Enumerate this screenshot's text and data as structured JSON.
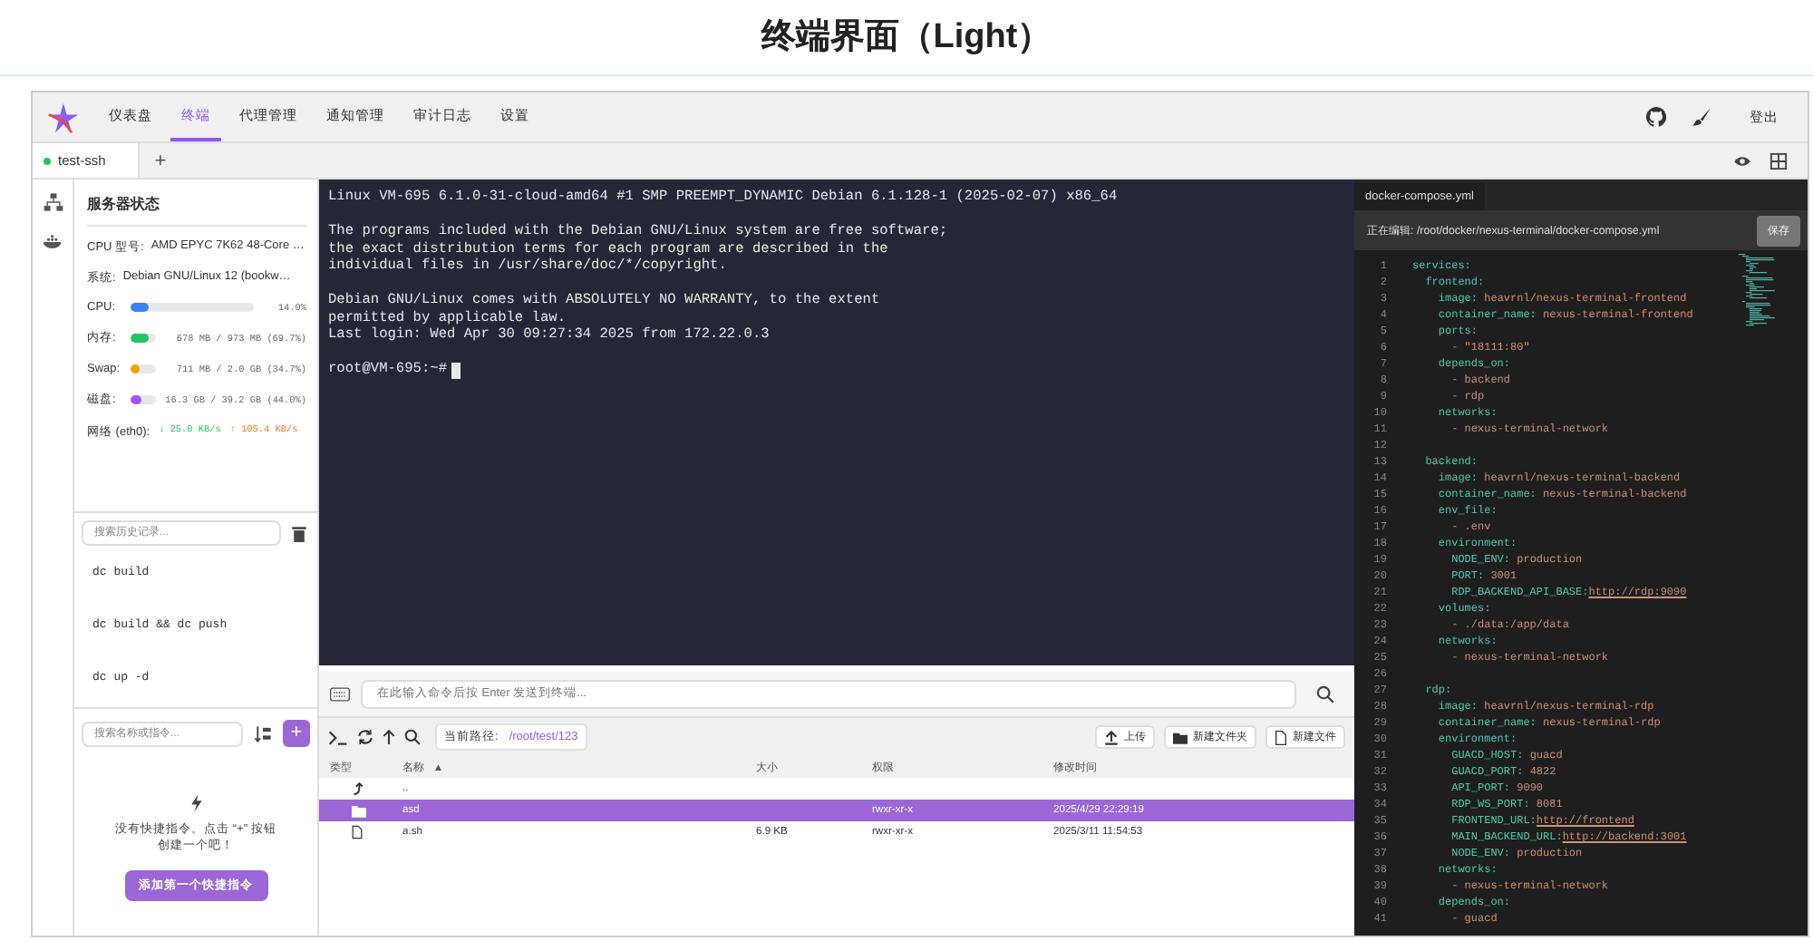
{
  "page_title": "终端界面（Light）",
  "nav": {
    "items": [
      {
        "label": "仪表盘",
        "selected": false
      },
      {
        "label": "终端",
        "selected": true
      },
      {
        "label": "代理管理",
        "selected": false
      },
      {
        "label": "通知管理",
        "selected": false
      },
      {
        "label": "审计日志",
        "selected": false
      },
      {
        "label": "设置",
        "selected": false
      }
    ],
    "logout": "登出"
  },
  "tabs": [
    {
      "label": "test-ssh",
      "selected": true,
      "connected": true
    }
  ],
  "add_tab": "+",
  "status": {
    "title": "服务器状态",
    "cpu_model_label": "CPU 型号:",
    "cpu_model": "AMD EPYC 7K62 48-Core …",
    "os_label": "系统:",
    "os": "Debian GNU/Linux 12 (bookw…",
    "meters": [
      {
        "label": "CPU:",
        "level": 0.14,
        "reading": "14.0%",
        "color": "#3b82f6"
      },
      {
        "label": "内存:",
        "level": 0.697,
        "reading": "678 MB / 973 MB (69.7%)",
        "color": "#22c55e"
      },
      {
        "label": "Swap:",
        "level": 0.347,
        "reading": "711 MB / 2.0 GB (34.7%)",
        "color": "#f59e0b"
      },
      {
        "label": "磁盘:",
        "level": 0.44,
        "reading": "16.3 GB / 39.2 GB (44.0%)",
        "color": "#a855f7"
      }
    ],
    "network": {
      "label": "网络 (eth0):",
      "down": "↓ 25.0 KB/s",
      "up": "↑ 105.4 KB/s"
    }
  },
  "history": {
    "placeholder": "搜索历史记录...",
    "items": [
      "dc build",
      "dc build && dc push",
      "dc up -d"
    ]
  },
  "quick": {
    "placeholder": "搜索名称或指令...",
    "add_symbol": "+",
    "empty_text": "没有快捷指令。点击 “+” 按钮创建一个吧！",
    "add_button": "添加第一个快捷指令"
  },
  "terminal": {
    "blocks": [
      [
        "Linux VM-695 6.1.0-31-cloud-amd64 #1 SMP PREEMPT_DYNAMIC Debian 6.1.128-1 (2025-02-07) x86_64"
      ],
      [
        "The programs included with the Debian GNU/Linux system are free software;",
        "the exact distribution terms for each program are described in the",
        "individual files in /usr/share/doc/*/copyright."
      ],
      [
        "Debian GNU/Linux comes with ABSOLUTELY NO WARRANTY, to the extent",
        "permitted by applicable law.",
        "Last login: Wed Apr 30 09:27:34 2025 from 172.22.0.3"
      ]
    ],
    "prompt": "root@VM-695:~#"
  },
  "command_input": {
    "placeholder": "在此输入命令后按 Enter 发送到终端..."
  },
  "files": {
    "path_label": "当前路径:",
    "path": "/root/test/123",
    "buttons": [
      "上传",
      "新建文件夹",
      "新建文件"
    ],
    "columns": [
      "类型",
      "名称",
      "大小",
      "权限",
      "修改时间"
    ],
    "sort_mark": "▲",
    "rows": [
      {
        "kind": "up",
        "name": "..",
        "selected": false
      },
      {
        "kind": "folder",
        "name": "asd",
        "perms": "rwxr-xr-x",
        "modified": "2025/4/29 22:29:19",
        "selected": true
      },
      {
        "kind": "file",
        "name": "a.sh",
        "size": "6.9 KB",
        "perms": "rwxr-xr-x",
        "modified": "2025/3/11 11:54:53",
        "selected": false
      }
    ]
  },
  "editor": {
    "tab": "docker-compose.yml",
    "editing_label": "正在编辑:",
    "path": "/root/docker/nexus-terminal/docker-compose.yml",
    "save": "保存",
    "lines": [
      {
        "n": "1",
        "k": "services:"
      },
      {
        "n": "2",
        "k": "  frontend:"
      },
      {
        "n": "3",
        "k": "    image:",
        "v": " heavrnl/nexus-terminal-frontend"
      },
      {
        "n": "4",
        "k": "    container_name:",
        "v": " nexus-terminal-frontend"
      },
      {
        "n": "5",
        "k": "    ports:"
      },
      {
        "n": "6",
        "v": "      - \"18111:80\""
      },
      {
        "n": "7",
        "k": "    depends_on:"
      },
      {
        "n": "8",
        "v": "      - backend"
      },
      {
        "n": "9",
        "v": "      - rdp"
      },
      {
        "n": "10",
        "k": "    networks:"
      },
      {
        "n": "11",
        "v": "      - nexus-terminal-network"
      },
      {
        "n": "12"
      },
      {
        "n": "13",
        "k": "  backend:"
      },
      {
        "n": "14",
        "k": "    image:",
        "v": " heavrnl/nexus-terminal-backend"
      },
      {
        "n": "15",
        "k": "    container_name:",
        "v": " nexus-terminal-backend"
      },
      {
        "n": "16",
        "k": "    env_file:"
      },
      {
        "n": "17",
        "v": "      - .env"
      },
      {
        "n": "18",
        "k": "    environment:"
      },
      {
        "n": "19",
        "k": "      NODE_ENV:",
        "v": " production"
      },
      {
        "n": "20",
        "k": "      PORT:",
        "v": " 3001"
      },
      {
        "n": "21",
        "k": "      RDP_BACKEND_API_BASE:",
        "v": "http://rdp:9090",
        "link": true
      },
      {
        "n": "22",
        "k": "    volumes:"
      },
      {
        "n": "23",
        "v": "      - ./data:/app/data"
      },
      {
        "n": "24",
        "k": "    networks:"
      },
      {
        "n": "25",
        "v": "      - nexus-terminal-network"
      },
      {
        "n": "26"
      },
      {
        "n": "27",
        "k": "  rdp:"
      },
      {
        "n": "28",
        "k": "    image:",
        "v": " heavrnl/nexus-terminal-rdp"
      },
      {
        "n": "29",
        "k": "    container_name:",
        "v": " nexus-terminal-rdp"
      },
      {
        "n": "30",
        "k": "    environment:"
      },
      {
        "n": "31",
        "k": "      GUACD_HOST:",
        "v": " guacd"
      },
      {
        "n": "32",
        "k": "      GUACD_PORT:",
        "v": " 4822"
      },
      {
        "n": "33",
        "k": "      API_PORT:",
        "v": " 9090"
      },
      {
        "n": "34",
        "k": "      RDP_WS_PORT:",
        "v": " 8081"
      },
      {
        "n": "35",
        "k": "      FRONTEND_URL:",
        "v": "http://frontend",
        "link": true
      },
      {
        "n": "36",
        "k": "      MAIN_BACKEND_URL:",
        "v": "http://backend:3001",
        "link": true
      },
      {
        "n": "37",
        "k": "      NODE_ENV:",
        "v": " production"
      },
      {
        "n": "38",
        "k": "    networks:"
      },
      {
        "n": "39",
        "v": "      - nexus-terminal-network"
      },
      {
        "n": "40",
        "k": "    depends_on:"
      },
      {
        "n": "41",
        "v": "      - guacd"
      }
    ]
  }
}
